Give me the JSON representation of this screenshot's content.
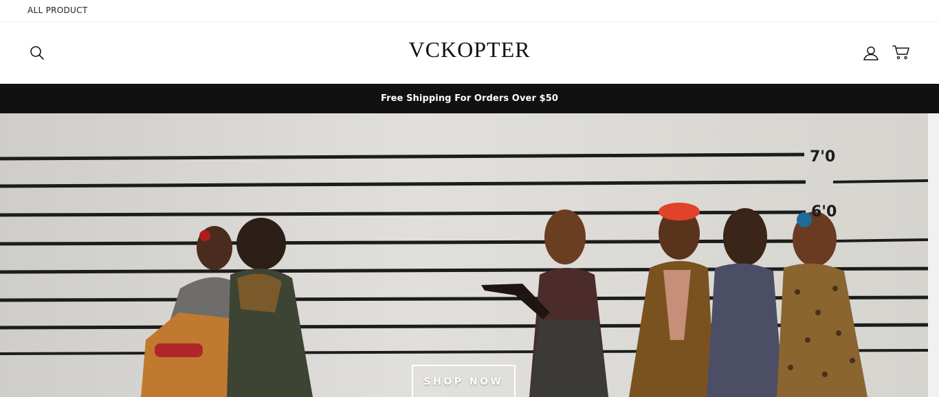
{
  "topbar": {
    "link": "ALL PRODUCT"
  },
  "header": {
    "logo": "VCKOPTER",
    "icons": {
      "search": "search-icon",
      "account": "user-icon",
      "cart": "cart-icon"
    }
  },
  "announcement": {
    "text": "Free Shipping For Orders Over $50"
  },
  "hero": {
    "button_label": "SHOP NOW",
    "height_marks": [
      "7'0",
      "6'0"
    ],
    "image_description_colors": {
      "wall": "#dcdad6",
      "lines": "#1a1a1a"
    }
  },
  "colors": {
    "announcement_bg": "#111111",
    "text": "#111111",
    "page_bg": "#ffffff"
  }
}
